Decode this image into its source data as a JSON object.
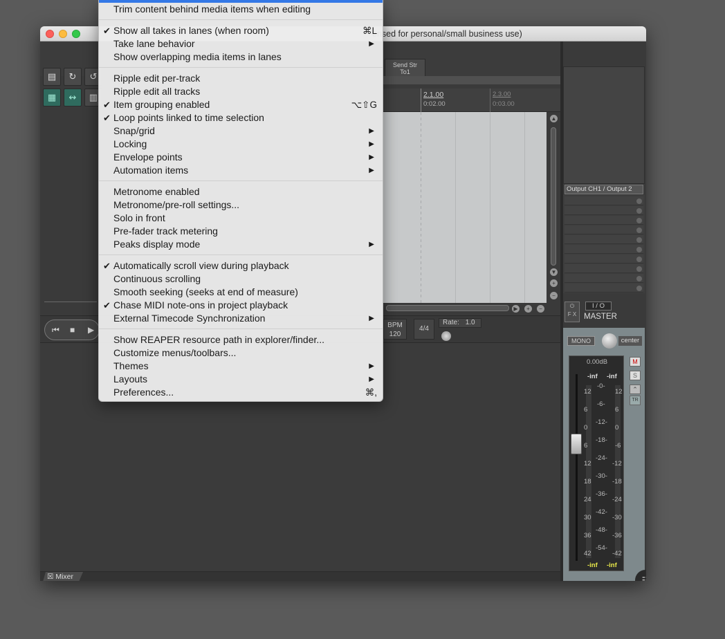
{
  "window": {
    "title_fragment": "ensed for personal/small business use)"
  },
  "toolbar": {
    "send_label_line1": "Send Str",
    "send_label_line2": "To1"
  },
  "ruler": {
    "mark1_bar": "2.1.00",
    "mark1_time": "0:02.00",
    "mark2_bar": "2.3.00",
    "mark2_time": "0:03.00"
  },
  "transport": {
    "bpm_label": "BPM",
    "bpm_value": "120",
    "time_signature": "4/4",
    "rate_label": "Rate:",
    "rate_value": "1.0"
  },
  "master": {
    "output_label": "Output CH1 / Output 2",
    "io_label": "I / O",
    "fx_label_top": "⏻",
    "fx_label_bottom": "F X",
    "name": "MASTER",
    "mono_label": "MONO",
    "pan_label": "center",
    "db_readout": "0.00dB",
    "peak_left": "-inf",
    "peak_right": "-inf",
    "peak_left_bottom": "-inf",
    "peak_right_bottom": "-inf",
    "m_label": "M",
    "s_label": "S",
    "tr_label": "TR",
    "scale_left": [
      "12",
      "6",
      "0",
      "6",
      "12",
      "18",
      "24",
      "30",
      "36",
      "42"
    ],
    "scale_center": [
      "-0-",
      "-6-",
      "-12-",
      "-18-",
      "-24-",
      "-30-",
      "-36-",
      "-42-",
      "-48-",
      "-54-"
    ],
    "scale_right": [
      "12",
      "6",
      "0",
      "-6",
      "-12",
      "-18",
      "-24",
      "-30",
      "-36",
      "-42"
    ]
  },
  "mixer": {
    "tab_label": "Mixer"
  },
  "menu": {
    "items": [
      {
        "label": "Trim content behind media items when editing",
        "checked": false,
        "shortcut": "",
        "submenu": false
      },
      {
        "label": "Show all takes in lanes (when room)",
        "checked": true,
        "shortcut": "⌘L",
        "submenu": false
      },
      {
        "label": "Take lane behavior",
        "checked": false,
        "shortcut": "",
        "submenu": true
      },
      {
        "label": "Show overlapping media items in lanes",
        "checked": false,
        "shortcut": "",
        "submenu": false
      },
      {
        "label": "Ripple edit per-track",
        "checked": false,
        "shortcut": "",
        "submenu": false
      },
      {
        "label": "Ripple edit all tracks",
        "checked": false,
        "shortcut": "",
        "submenu": false
      },
      {
        "label": "Item grouping enabled",
        "checked": true,
        "shortcut": "⌥⇧G",
        "submenu": false
      },
      {
        "label": "Loop points linked to time selection",
        "checked": true,
        "shortcut": "",
        "submenu": false
      },
      {
        "label": "Snap/grid",
        "checked": false,
        "shortcut": "",
        "submenu": true
      },
      {
        "label": "Locking",
        "checked": false,
        "shortcut": "",
        "submenu": true
      },
      {
        "label": "Envelope points",
        "checked": false,
        "shortcut": "",
        "submenu": true
      },
      {
        "label": "Automation items",
        "checked": false,
        "shortcut": "",
        "submenu": true
      },
      {
        "label": "Metronome enabled",
        "checked": false,
        "shortcut": "",
        "submenu": false
      },
      {
        "label": "Metronome/pre-roll settings...",
        "checked": false,
        "shortcut": "",
        "submenu": false
      },
      {
        "label": "Solo in front",
        "checked": false,
        "shortcut": "",
        "submenu": false
      },
      {
        "label": "Pre-fader track metering",
        "checked": false,
        "shortcut": "",
        "submenu": false
      },
      {
        "label": "Peaks display mode",
        "checked": false,
        "shortcut": "",
        "submenu": true
      },
      {
        "label": "Automatically scroll view during playback",
        "checked": true,
        "shortcut": "",
        "submenu": false
      },
      {
        "label": "Continuous scrolling",
        "checked": false,
        "shortcut": "",
        "submenu": false
      },
      {
        "label": "Smooth seeking (seeks at end of measure)",
        "checked": false,
        "shortcut": "",
        "submenu": false
      },
      {
        "label": "Chase MIDI note-ons in project playback",
        "checked": true,
        "shortcut": "",
        "submenu": false
      },
      {
        "label": "External Timecode Synchronization",
        "checked": false,
        "shortcut": "",
        "submenu": true
      },
      {
        "label": "Show REAPER resource path in explorer/finder...",
        "checked": false,
        "shortcut": "",
        "submenu": false
      },
      {
        "label": "Customize menus/toolbars...",
        "checked": false,
        "shortcut": "",
        "submenu": false
      },
      {
        "label": "Themes",
        "checked": false,
        "shortcut": "",
        "submenu": true
      },
      {
        "label": "Layouts",
        "checked": false,
        "shortcut": "",
        "submenu": true
      },
      {
        "label": "Preferences...",
        "checked": false,
        "shortcut": "⌘,",
        "submenu": false
      }
    ],
    "check_glyph": "✔",
    "arrow_glyph": "▶"
  }
}
